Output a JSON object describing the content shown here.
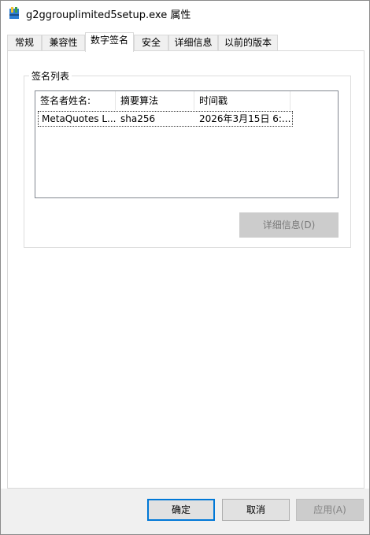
{
  "window": {
    "title": "g2ggrouplimited5setup.exe 属性",
    "icon": "installer-icon"
  },
  "tabs": [
    {
      "label": "常规"
    },
    {
      "label": "兼容性"
    },
    {
      "label": "数字签名"
    },
    {
      "label": "安全"
    },
    {
      "label": "详细信息"
    },
    {
      "label": "以前的版本"
    }
  ],
  "active_tab": "数字签名",
  "signature_list": {
    "group_label": "签名列表",
    "columns": [
      "签名者姓名:",
      "摘要算法",
      "时间戳"
    ],
    "rows": [
      {
        "signer": "MetaQuotes L...",
        "algorithm": "sha256",
        "timestamp": "2026年3月15日 6:..."
      }
    ],
    "details_button": "详细信息(D)"
  },
  "footer": {
    "ok": "确定",
    "cancel": "取消",
    "apply": "应用(A)"
  },
  "colors": {
    "accent": "#0078d7",
    "disabled_button": "#cccccc",
    "tab_inactive": "#f0f0f0"
  }
}
